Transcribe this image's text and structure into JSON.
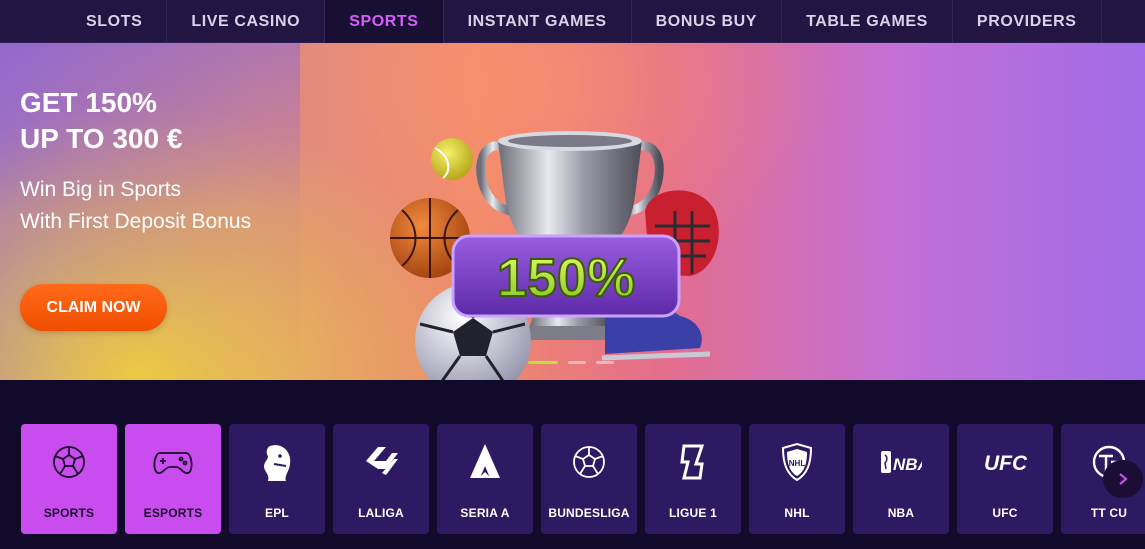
{
  "nav": {
    "tabs": [
      {
        "label": "SLOTS",
        "active": false
      },
      {
        "label": "LIVE CASINO",
        "active": false
      },
      {
        "label": "SPORTS",
        "active": true
      },
      {
        "label": "INSTANT GAMES",
        "active": false
      },
      {
        "label": "BONUS BUY",
        "active": false
      },
      {
        "label": "TABLE GAMES",
        "active": false
      },
      {
        "label": "PROVIDERS",
        "active": false
      }
    ]
  },
  "hero": {
    "title_line1": "GET 150%",
    "title_line2": "UP TO 300 €",
    "sub_line1": "Win Big in Sports",
    "sub_line2": "With First Deposit Bonus",
    "cta": "CLAIM NOW",
    "badge_text": "150%",
    "slides_total": 3,
    "slide_active": 1
  },
  "categories": [
    {
      "label": "SPORTS",
      "icon": "soccer-ball-icon",
      "highlight": true
    },
    {
      "label": "ESPORTS",
      "icon": "gamepad-icon",
      "highlight": true
    },
    {
      "label": "EPL",
      "icon": "epl-lion-icon",
      "highlight": false
    },
    {
      "label": "LALIGA",
      "icon": "laliga-icon",
      "highlight": false
    },
    {
      "label": "SERIA A",
      "icon": "serie-a-icon",
      "highlight": false
    },
    {
      "label": "BUNDESLIGA",
      "icon": "soccer-ball-icon",
      "highlight": false
    },
    {
      "label": "LIGUE 1",
      "icon": "ligue1-icon",
      "highlight": false
    },
    {
      "label": "NHL",
      "icon": "nhl-shield-icon",
      "highlight": false
    },
    {
      "label": "NBA",
      "icon": "nba-logo-icon",
      "highlight": false
    },
    {
      "label": "UFC",
      "icon": "ufc-logo-icon",
      "highlight": false
    },
    {
      "label": "TT CU",
      "icon": "tt-cup-icon",
      "highlight": false
    }
  ],
  "colors": {
    "accent": "#d85cff",
    "cta": "#f45a0a",
    "tile": "#2e1a63",
    "tile_highlight": "#c94dee"
  }
}
